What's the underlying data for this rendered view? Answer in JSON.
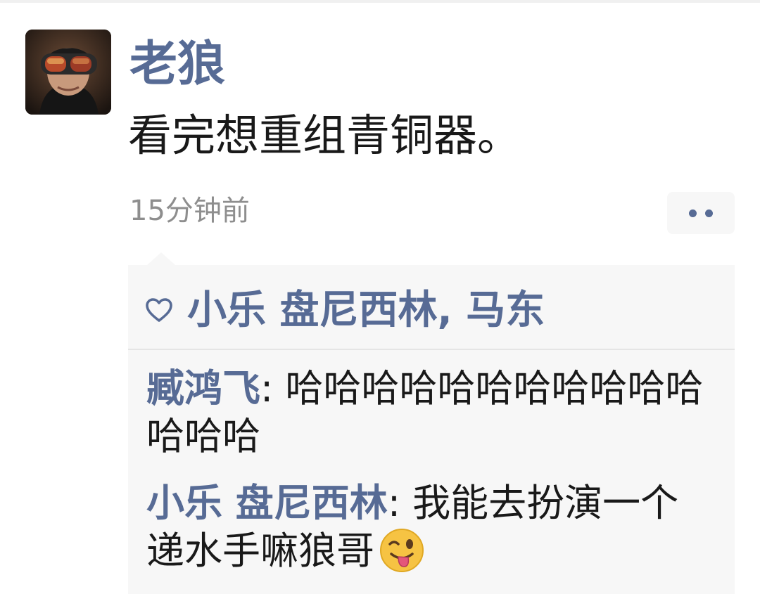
{
  "post": {
    "author": "老狼",
    "text": "看完想重组青铜器。",
    "timestamp": "15分钟前",
    "avatar_icon": "avatar-photo-goggles"
  },
  "more_button": {
    "icon": "more-dots-icon"
  },
  "likes": {
    "icon": "heart-outline-icon",
    "names": "小乐 盘尼西林, 马东"
  },
  "comments": [
    {
      "author": "臧鸿飞",
      "separator": ": ",
      "text": "哈哈哈哈哈哈哈哈哈哈哈哈哈哈"
    },
    {
      "author": "小乐 盘尼西林",
      "separator": ": ",
      "text": "我能去扮演一个递水手嘛狼哥",
      "emoji": "winking-tongue-emoji"
    }
  ],
  "colors": {
    "link_blue": "#576b95",
    "text_dark": "#191919",
    "time_gray": "#8e8e8e",
    "comment_bg": "#f7f7f7"
  }
}
